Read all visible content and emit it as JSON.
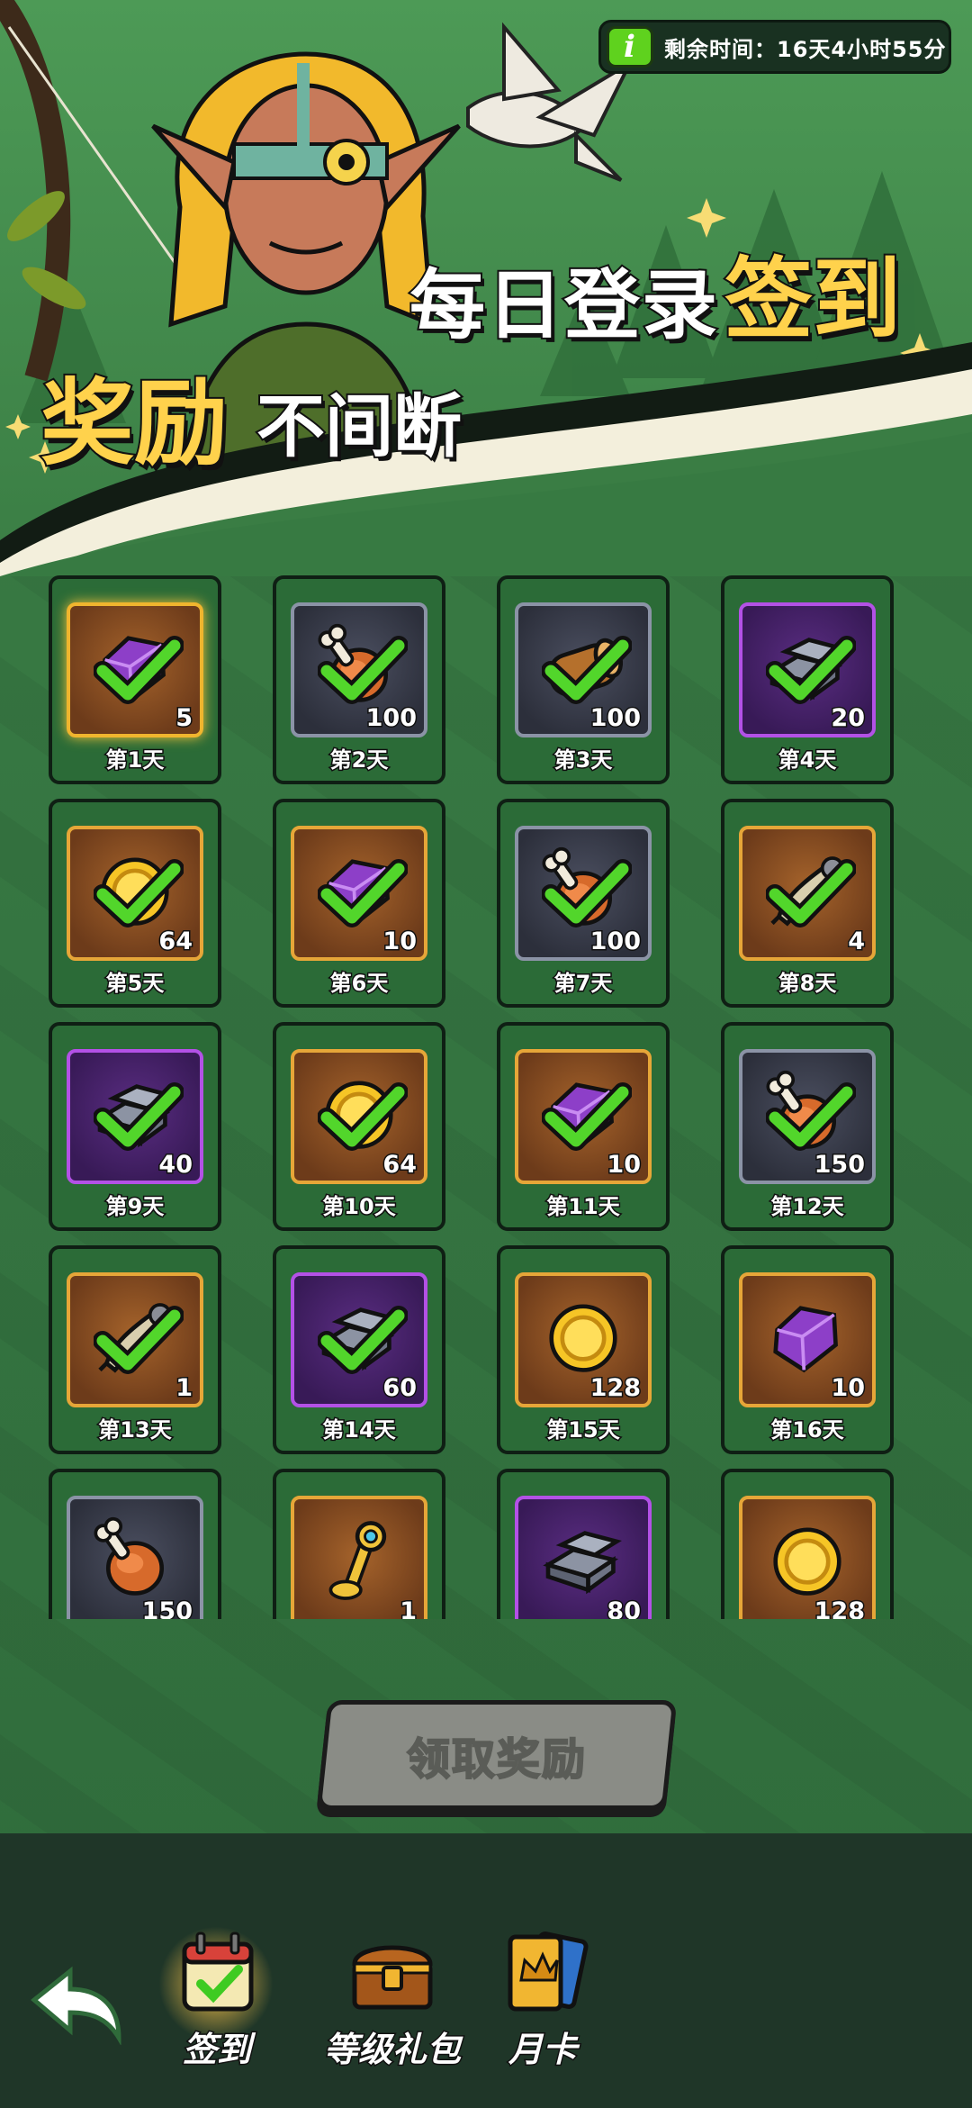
{
  "header": {
    "timer_icon": "i",
    "timer_text": "剩余时间：16天4小时55分",
    "headline_line1": "每日登录",
    "headline_line1_gold": "签到",
    "headline_line2_gold": "奖励",
    "headline_line2": "不间断"
  },
  "grid": {
    "items": [
      {
        "day": "第1天",
        "qty": "5",
        "icon": "purple-gem-icon",
        "rarity": "gold",
        "claimed": true
      },
      {
        "day": "第2天",
        "qty": "100",
        "icon": "meat-icon",
        "rarity": "grey",
        "claimed": true
      },
      {
        "day": "第3天",
        "qty": "100",
        "icon": "wood-log-icon",
        "rarity": "grey",
        "claimed": true
      },
      {
        "day": "第4天",
        "qty": "20",
        "icon": "iron-ingot-icon",
        "rarity": "purple",
        "claimed": true
      },
      {
        "day": "第5天",
        "qty": "64",
        "icon": "gold-coin-icon",
        "rarity": "orange",
        "claimed": true
      },
      {
        "day": "第6天",
        "qty": "10",
        "icon": "purple-gem-icon",
        "rarity": "orange",
        "claimed": true
      },
      {
        "day": "第7天",
        "qty": "100",
        "icon": "meat-icon",
        "rarity": "grey",
        "claimed": true
      },
      {
        "day": "第8天",
        "qty": "4",
        "icon": "scroll-icon",
        "rarity": "orange",
        "claimed": true
      },
      {
        "day": "第9天",
        "qty": "40",
        "icon": "iron-ingot-icon",
        "rarity": "purple",
        "claimed": true
      },
      {
        "day": "第10天",
        "qty": "64",
        "icon": "gold-coin-icon",
        "rarity": "orange",
        "claimed": true
      },
      {
        "day": "第11天",
        "qty": "10",
        "icon": "purple-gem-icon",
        "rarity": "orange",
        "claimed": true
      },
      {
        "day": "第12天",
        "qty": "150",
        "icon": "meat-icon",
        "rarity": "grey",
        "claimed": true
      },
      {
        "day": "第13天",
        "qty": "1",
        "icon": "scroll-icon",
        "rarity": "orange",
        "claimed": true
      },
      {
        "day": "第14天",
        "qty": "60",
        "icon": "iron-ingot-icon",
        "rarity": "purple",
        "claimed": true
      },
      {
        "day": "第15天",
        "qty": "128",
        "icon": "gold-coin-icon",
        "rarity": "orange",
        "claimed": false
      },
      {
        "day": "第16天",
        "qty": "10",
        "icon": "purple-gem-icon",
        "rarity": "orange",
        "claimed": false
      },
      {
        "day": "",
        "qty": "150",
        "icon": "meat-icon",
        "rarity": "grey",
        "claimed": false
      },
      {
        "day": "",
        "qty": "1",
        "icon": "golden-key-icon",
        "rarity": "orange",
        "claimed": false
      },
      {
        "day": "",
        "qty": "80",
        "icon": "iron-ingot-icon",
        "rarity": "purple",
        "claimed": false
      },
      {
        "day": "",
        "qty": "128",
        "icon": "gold-coin-icon",
        "rarity": "orange",
        "claimed": false
      }
    ]
  },
  "claim_button": {
    "label": "领取奖励",
    "enabled": false
  },
  "nav": {
    "back_icon": "back-arrow-icon",
    "tabs": [
      {
        "label": "签到",
        "icon": "calendar-check-icon",
        "active": true
      },
      {
        "label": "等级礼包",
        "icon": "treasure-chest-icon",
        "active": false
      },
      {
        "label": "月卡",
        "icon": "month-card-icon",
        "active": false
      }
    ]
  }
}
